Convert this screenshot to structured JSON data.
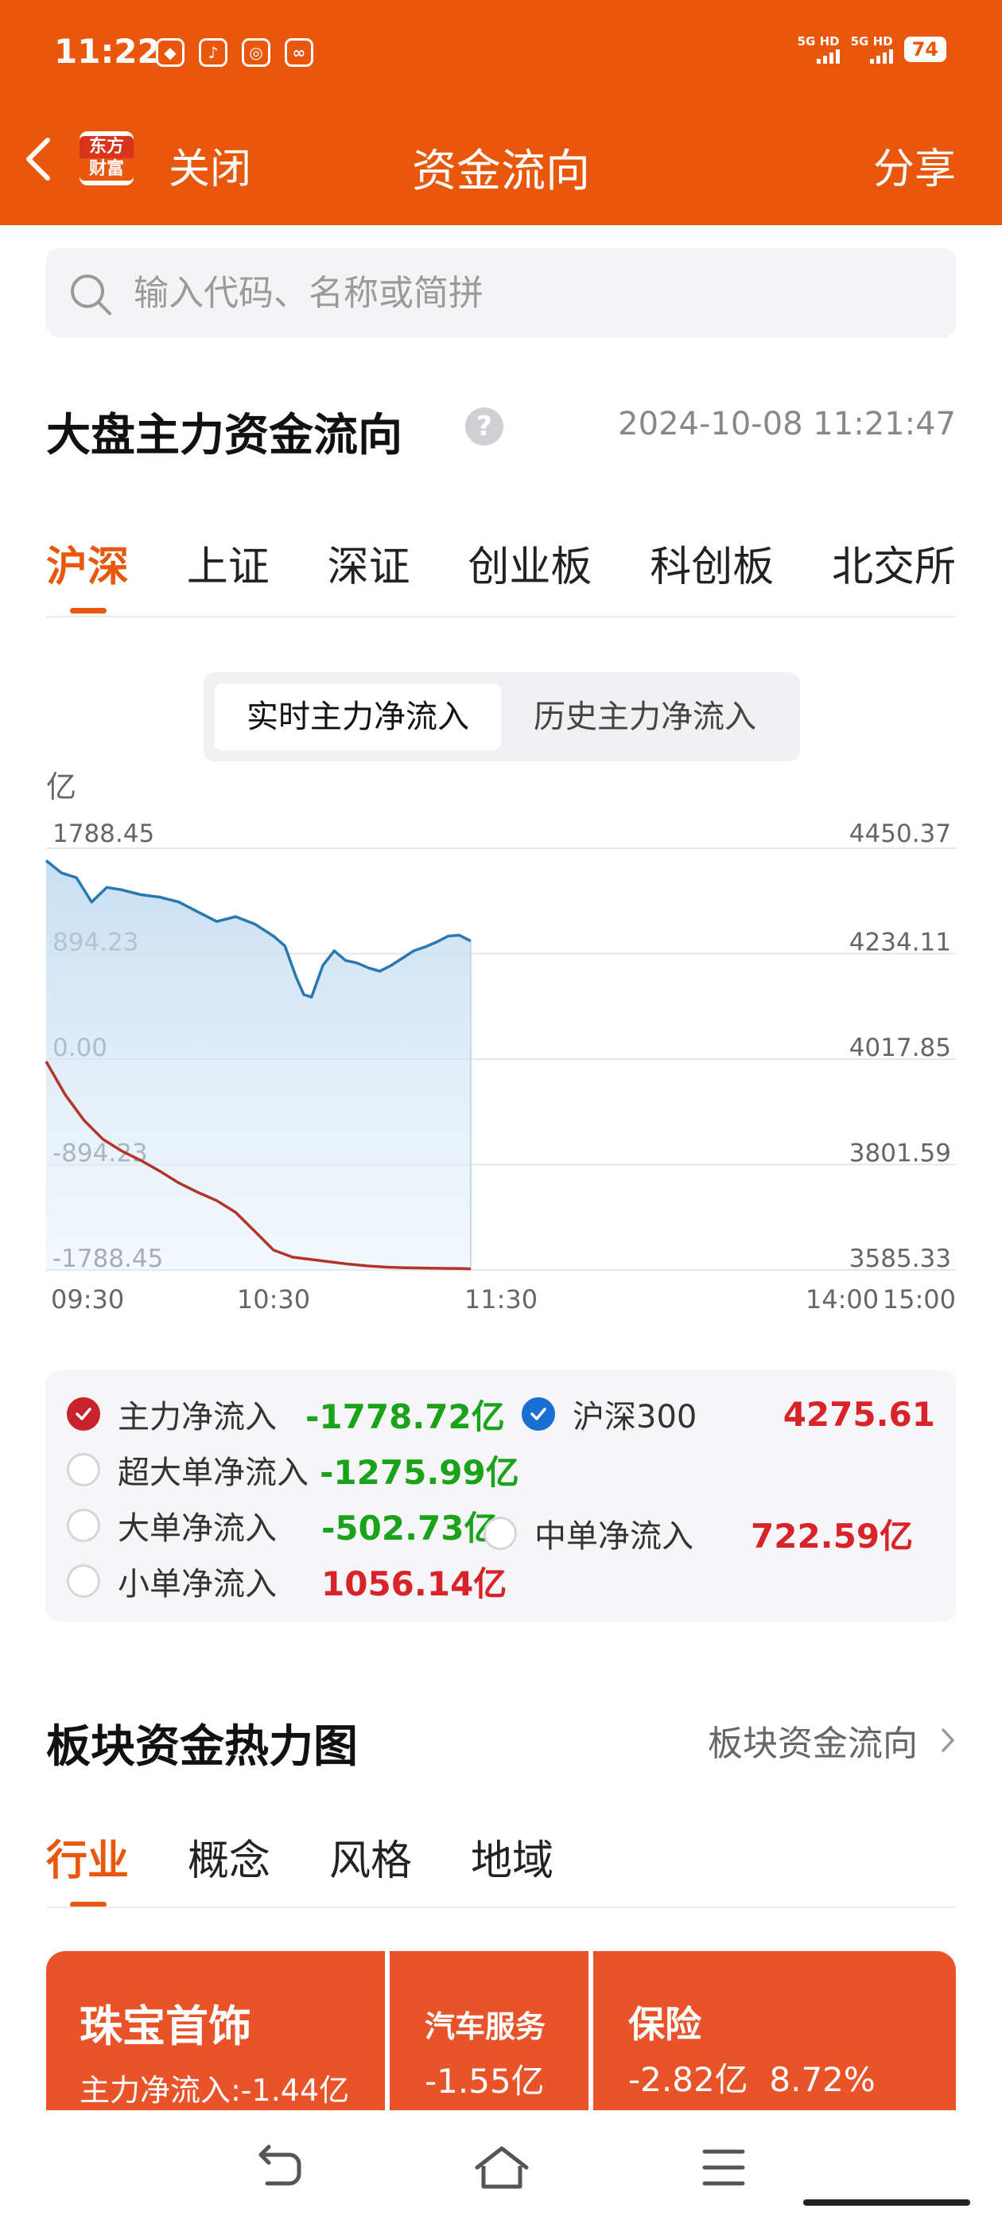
{
  "status_bar": {
    "time": "11:22",
    "network1": "5G HD",
    "network2": "5G HD",
    "battery": "74"
  },
  "nav": {
    "logo_line1": "东方",
    "logo_line2": "财富",
    "close_label": "关闭",
    "title": "资金流向",
    "share_label": "分享"
  },
  "search": {
    "placeholder": "输入代码、名称或简拼"
  },
  "market_flow": {
    "title": "大盘主力资金流向",
    "help": "?",
    "timestamp": "2024-10-08 11:21:47",
    "tabs": [
      "沪深",
      "上证",
      "深证",
      "创业板",
      "科创板",
      "北交所"
    ],
    "active_tab": 0,
    "segment": {
      "realtime": "实时主力净流入",
      "history": "历史主力净流入",
      "selected": "realtime"
    }
  },
  "chart_data": {
    "type": "line",
    "unit_label": "亿",
    "left_axis_ticks": [
      "1788.45",
      "894.23",
      "0.00",
      "-894.23",
      "-1788.45"
    ],
    "left_axis_range": [
      -1788.45,
      1788.45
    ],
    "right_axis_ticks": [
      "4450.37",
      "4234.11",
      "4017.85",
      "3801.59",
      "3585.33"
    ],
    "right_axis_range": [
      3585.33,
      4450.37
    ],
    "x_ticks": [
      "09:30",
      "10:30",
      "11:30",
      "14:00",
      "15:00"
    ],
    "x_range_minutes": [
      0,
      240
    ],
    "grid": true,
    "series": [
      {
        "name": "主力净流入",
        "axis": "left",
        "color": "#B3342A",
        "x": [
          0,
          5,
          10,
          15,
          20,
          25,
          30,
          35,
          40,
          45,
          50,
          55,
          60,
          65,
          70,
          75,
          80,
          85,
          90,
          95,
          100,
          105,
          110,
          112
        ],
        "y": [
          -20,
          -300,
          -520,
          -680,
          -780,
          -860,
          -950,
          -1050,
          -1130,
          -1200,
          -1300,
          -1460,
          -1620,
          -1680,
          -1700,
          -1720,
          -1740,
          -1755,
          -1765,
          -1770,
          -1772,
          -1775,
          -1777,
          -1778.72
        ]
      },
      {
        "name": "沪深300",
        "axis": "right",
        "color": "#2A78B0",
        "x": [
          0,
          4,
          8,
          12,
          16,
          20,
          25,
          30,
          35,
          40,
          45,
          50,
          55,
          60,
          63,
          66,
          68,
          70,
          73,
          76,
          79,
          82,
          85,
          88,
          91,
          94,
          97,
          100,
          103,
          106,
          109,
          112
        ],
        "y": [
          4425,
          4400,
          4390,
          4340,
          4370,
          4365,
          4355,
          4350,
          4340,
          4320,
          4300,
          4310,
          4295,
          4270,
          4250,
          4185,
          4150,
          4145,
          4210,
          4240,
          4220,
          4215,
          4205,
          4198,
          4210,
          4225,
          4240,
          4248,
          4258,
          4270,
          4272,
          4260
        ]
      }
    ]
  },
  "legend": {
    "items": [
      {
        "label": "主力净流入",
        "value": "-1778.72亿",
        "checked": true,
        "sign": "neg"
      },
      {
        "label": "沪深300",
        "value": "4275.61",
        "checked": true,
        "sign": "pos"
      },
      {
        "label": "超大单净流入",
        "value": "-1275.99亿",
        "checked": false,
        "sign": "neg"
      },
      {
        "label": "大单净流入",
        "value": "-502.73亿",
        "checked": false,
        "sign": "neg"
      },
      {
        "label": "中单净流入",
        "value": "722.59亿",
        "checked": false,
        "sign": "pos"
      },
      {
        "label": "小单净流入",
        "value": "1056.14亿",
        "checked": false,
        "sign": "pos"
      }
    ]
  },
  "heatmap": {
    "title": "板块资金热力图",
    "more_link": "板块资金流向",
    "tabs": [
      "行业",
      "概念",
      "风格",
      "地域"
    ],
    "active_tab": 0,
    "cells": [
      {
        "name": "珠宝首饰",
        "line": "主力净流入:-1.44亿"
      },
      {
        "name": "汽车服务",
        "line": "-1.55亿"
      },
      {
        "name": "保险",
        "line": "-2.82亿  8.72%"
      }
    ],
    "cell_color": "#E8532A"
  },
  "colors": {
    "brand_orange": "#E9570C",
    "negative_green": "#1AA31A",
    "positive_red": "#D8232A"
  }
}
